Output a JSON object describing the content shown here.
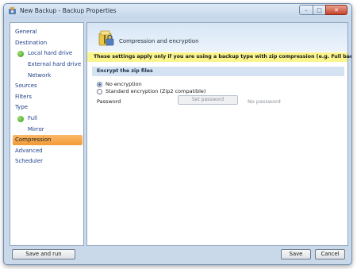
{
  "window": {
    "title": "New Backup - Backup Properties"
  },
  "caption_buttons": {
    "minimize": "–",
    "maximize": "□",
    "close": "✕"
  },
  "sidebar": {
    "items": [
      {
        "label": "General"
      },
      {
        "label": "Destination"
      },
      {
        "label": "Local hard drive",
        "icon": "check-icon"
      },
      {
        "label": "External hard drive"
      },
      {
        "label": "Network"
      },
      {
        "label": "Sources"
      },
      {
        "label": "Filters"
      },
      {
        "label": "Type"
      },
      {
        "label": "Full",
        "icon": "check-icon"
      },
      {
        "label": "Mirror"
      },
      {
        "label": "Compression",
        "selected": true
      },
      {
        "label": "Advanced"
      },
      {
        "label": "Scheduler"
      }
    ]
  },
  "content": {
    "header_title": "Compression and encryption",
    "note": "These settings apply only if you are using a backup type with zip compression (e.g. Full backup)",
    "group_title": "Encrypt the zip files",
    "options": [
      {
        "label": "No encryption",
        "selected": true
      },
      {
        "label": "Standard encryption (Zip2 compatible)",
        "selected": false
      }
    ],
    "password_label": "Password",
    "set_password_button": "Set password",
    "password_status": "No password"
  },
  "footer": {
    "save_and_run": "Save and run",
    "save": "Save",
    "cancel": "Cancel"
  },
  "colors": {
    "selected_item": "#f39a34",
    "note_background": "#faf58c",
    "nav_text": "#1e3f8a"
  }
}
